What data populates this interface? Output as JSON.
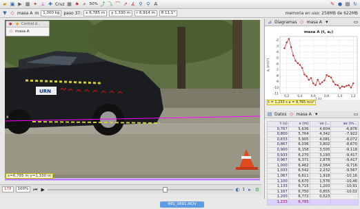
{
  "toolbar": {
    "track_select": "masa A",
    "mass_value": "1,000 kg",
    "step_label": "paso 37:",
    "x_field": "x 6,785 m",
    "y_field": "y 1,330 m",
    "r_field": "r 6,914 m",
    "theta_field": "θ 11,1°",
    "cross_label": "Cruz",
    "zoom_value": "50%",
    "memory_text": "memoria en uso: 258MB de 622MB"
  },
  "control_window": {
    "title": "Control d...",
    "item": "masa A"
  },
  "video": {
    "coord_readout": "x=6,785 m  y=1,330 m",
    "axis_label": "x"
  },
  "player": {
    "frame": "178",
    "zoom": "100%",
    "step": "1"
  },
  "video_tab": "IMG_0891.MOV",
  "diagram_panel": {
    "tab_label": "Diagramas",
    "track": "masa A",
    "status": "t = 1,233 s  a = 9,765 m/s²"
  },
  "chart_data": {
    "type": "line",
    "title": "masa A (t, aᵧ)",
    "xlabel": "t (s)",
    "ylabel": "aᵧ (m/s²)",
    "xlim": [
      0.1,
      1.26
    ],
    "ylim": [
      -11,
      -1.4
    ],
    "xticks": [
      "0,2",
      "0,4",
      "0,6",
      "0,8",
      "1,0",
      "1,2"
    ],
    "yticks": [
      "-2",
      "-3",
      "-4",
      "-5",
      "-6",
      "-7",
      "-8",
      "-9",
      "-10",
      "-11"
    ],
    "x": [
      0.167,
      0.2,
      0.233,
      0.267,
      0.3,
      0.333,
      0.367,
      0.4,
      0.433,
      0.467,
      0.5,
      0.533,
      0.567,
      0.6,
      0.633,
      0.667,
      0.7,
      0.733,
      0.767,
      0.8,
      0.833,
      0.867,
      0.9,
      0.933,
      0.967,
      1.0,
      1.033,
      1.067,
      1.1,
      1.133,
      1.167,
      1.2
    ],
    "y": [
      -3.4,
      -2.4,
      -1.8,
      -3.2,
      -4.6,
      -5.5,
      -5.9,
      -6.2,
      -6.7,
      -7.8,
      -8.1,
      -8.7,
      -8.4,
      -9.3,
      -9.6,
      -8.7,
      -9.4,
      -9.1,
      -8.8,
      -7.9,
      -8.1,
      -8.3,
      -9.0,
      -9.5,
      -9.6,
      -10.1,
      -9.8,
      -9.9,
      -9.7,
      -9.6,
      -10.0,
      -9.3
    ]
  },
  "data_panel": {
    "tab_label": "Datos",
    "track": "masa A",
    "columns": [
      "t (s)",
      "x (m)",
      "vx (...",
      "ax (m..."
    ],
    "rows": [
      [
        "0,767",
        "5,636",
        "4,604",
        "-6,876"
      ],
      [
        "0,800",
        "5,764",
        "4,342",
        "-7,922"
      ],
      [
        "0,833",
        "5,905",
        "4,081",
        "-8,072"
      ],
      [
        "0,867",
        "6,036",
        "3,802",
        "-8,670"
      ],
      [
        "0,900",
        "6,158",
        "3,505",
        "-9,118"
      ],
      [
        "0,933",
        "6,270",
        "3,193",
        "-9,417"
      ],
      [
        "0,967",
        "6,371",
        "2,878",
        "-9,417"
      ],
      [
        "1,000",
        "6,462",
        "2,564",
        "-9,716"
      ],
      [
        "1,033",
        "6,542",
        "2,232",
        "-9,567"
      ],
      [
        "1,067",
        "6,611",
        "1,918",
        "-10,16"
      ],
      [
        "1,100",
        "6,670",
        "1,576",
        "-10,46"
      ],
      [
        "1,133",
        "6,715",
        "1,203",
        "-10,91"
      ],
      [
        "1,167",
        "6,750",
        "0,855",
        "-10,02"
      ],
      [
        "1,200",
        "6,772",
        "0,523",
        ""
      ],
      [
        "1,233",
        "6,785",
        "",
        ""
      ]
    ]
  }
}
